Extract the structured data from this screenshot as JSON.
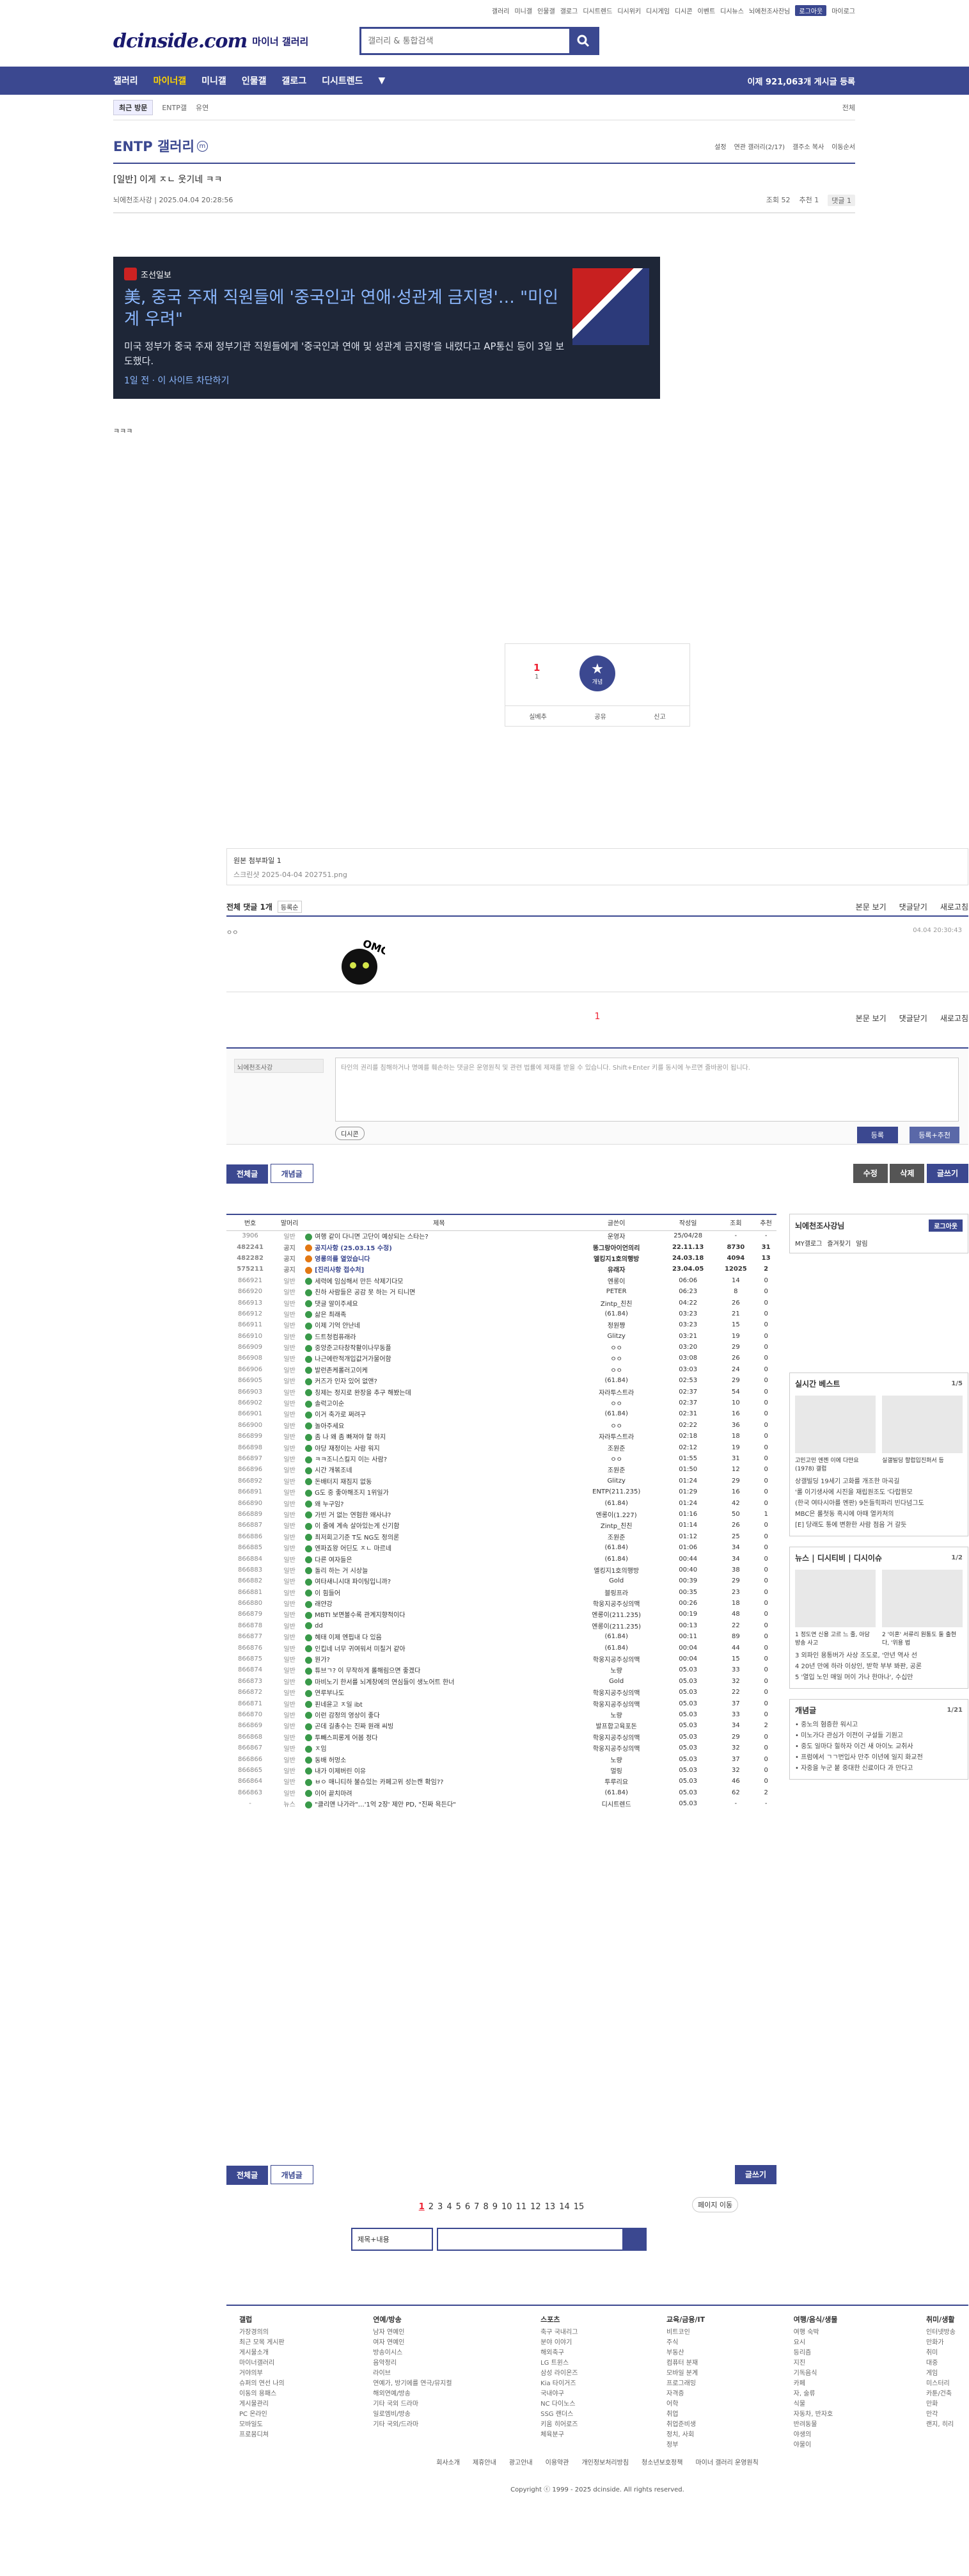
{
  "topnav": [
    "갤러리",
    "미니갤",
    "인물갤",
    "갤로그",
    "디시트렌드",
    "디시위키",
    "디시게임",
    "디시콘",
    "이벤트",
    "디시뉴스",
    "뇌에천조사잔님",
    "로그아웃",
    "마이로그"
  ],
  "logo": "dcinside.com",
  "logo_sub": "마이너 갤러리",
  "search_placeholder": "갤러리 & 통합검색",
  "gnb": [
    "갤러리",
    "마이너갤",
    "미니갤",
    "인물갤",
    "갤로그",
    "디시트렌드"
  ],
  "gnb_count": "이제 921,063개 게시글 등록",
  "sub": {
    "recent": "최근 방문",
    "items": [
      "ENTP갤",
      "유연"
    ],
    "all": "전체"
  },
  "gallery": {
    "title": "ENTP 갤러리",
    "badge": "m",
    "opts": [
      "설정",
      "연관 갤러리(2/17)",
      "갤주소 복사",
      "이동순서"
    ]
  },
  "post": {
    "title": "[일반] 이게 ㅈㄴ 웃기네 ㅋㅋ",
    "author": "뇌에천조사강",
    "date": "2025.04.04 20:28:56",
    "views": "조회 52",
    "rec": "추천 1",
    "cmt": "댓글 1"
  },
  "news": {
    "source": "조선일보",
    "title": "美, 중국 주재 직원들에 '중국인과 연애·성관계 금지령'… \"미인계 우려\"",
    "desc": "미국 정부가 중국 주재 정부기관 직원들에게 '중국인과 연애 및 성관계 금지령'을 내렸다고 AP통신 등이 3일 보도했다.",
    "time": "1일 전",
    "block": "이 사이트 차단하기"
  },
  "body": "ㅋㅋㅋ",
  "rec": {
    "count": "1",
    "fix": "1",
    "star": "개념",
    "b1": "실베추",
    "b2": "공유",
    "b3": "신고"
  },
  "attach": {
    "title": "원본 첨부파일 1",
    "file": "스크린샷 2025-04-04 202751.png"
  },
  "cmthead": {
    "label": "전체 댓글 1개",
    "sort": "등록순",
    "r": [
      "본문 보기",
      "댓글닫기",
      "새로고침"
    ]
  },
  "comment": {
    "nick": "ㅇㅇ",
    "time": "04.04 20:30:43",
    "sticker": "OMG"
  },
  "pg": "1",
  "write": {
    "nick": "뇌에천조사강",
    "ph": "타인의 권리를 침해하거나 명예를 훼손하는 댓글은 운영원칙 및 관련 법률에 제재를 받을 수 있습니다. Shift+Enter 키를 동시에 누르면 줄바꿈이 됩니다.",
    "dc": "디시콘",
    "b1": "등록",
    "b2": "등록+추천"
  },
  "btns": {
    "all": "전체글",
    "best": "개념글",
    "edit": "수정",
    "del": "삭제",
    "write": "글쓰기"
  },
  "list_head": [
    "번호",
    "말머리",
    "제목",
    "글쓴이",
    "작성일",
    "조회",
    "추천"
  ],
  "rows": [
    [
      "3906",
      "일반",
      "여행 같이 다니면 고단이 예상되는 스타는?",
      "운영자",
      "25/04/28",
      "-",
      "-"
    ],
    [
      "482241",
      "공지",
      "공지사항 (25.03.15 수정)",
      "똥그랑아이언의리",
      "22.11.13",
      "8730",
      "31"
    ],
    [
      "482282",
      "공지",
      "영롱의를 열었습니다",
      "엘킹지1호의행방",
      "24.03.18",
      "4094",
      "13"
    ],
    [
      "575211",
      "공지",
      "[진리사항 접수처]",
      "유래자",
      "23.04.05",
      "12025",
      "2"
    ],
    [
      "866921",
      "일반",
      "세력에 임심해서 만든 삭제기다모",
      "엔롱이",
      "06:06",
      "14",
      "0"
    ],
    [
      "866920",
      "일반",
      "친하 사람들은 공감 못 하는 거 티니면",
      "PETER",
      "06:23",
      "8",
      "0"
    ],
    [
      "866913",
      "일반",
      "댓글 알이주세요",
      "Zintp_친친",
      "04:22",
      "26",
      "0"
    ],
    [
      "866912",
      "일반",
      "삶은 최래족",
      "(61.84)",
      "03:23",
      "21",
      "0"
    ],
    [
      "866911",
      "일반",
      "이제 기억 안난네",
      "정원쨩",
      "03:23",
      "15",
      "0"
    ],
    [
      "866910",
      "일반",
      "드트청컴퓨래라",
      "Glitzy",
      "03:21",
      "19",
      "0"
    ],
    [
      "866909",
      "일반",
      "중앙준고타창작활이나무동플",
      "ㅇㅇ",
      "03:20",
      "29",
      "0"
    ],
    [
      "866908",
      "일반",
      "나근에란적개입값거가물어함",
      "ㅇㅇ",
      "03:08",
      "26",
      "0"
    ],
    [
      "866906",
      "일반",
      "발런존케롤러고이케",
      "ㅇㅇ",
      "03:03",
      "24",
      "0"
    ],
    [
      "866905",
      "일반",
      "커즈가 인자 있어 없앤?",
      "(61.84)",
      "02:53",
      "29",
      "0"
    ],
    [
      "866903",
      "일반",
      "칭제는 정지로 완장을 추구 해봤는데",
      "자라투스트라",
      "02:37",
      "54",
      "0"
    ],
    [
      "866902",
      "일반",
      "솔럭고이순",
      "ㅇㅇ",
      "02:37",
      "10",
      "0"
    ],
    [
      "866901",
      "일반",
      "이거 축가로 쩌려구",
      "(61.84)",
      "02:31",
      "16",
      "0"
    ],
    [
      "866900",
      "일반",
      "놀아주세요",
      "ㅇㅇ",
      "02:22",
      "36",
      "0"
    ],
    [
      "866899",
      "일반",
      "좀 나 왜 좀 빠져야 할 하지",
      "자라투스트라",
      "02:18",
      "18",
      "0"
    ],
    [
      "866898",
      "일반",
      "야당 재정이는 사람 워지",
      "조원준",
      "02:12",
      "19",
      "0"
    ],
    [
      "866897",
      "일반",
      "ㅋㅋ조니스킬지 이는 사람?",
      "ㅇㅇ",
      "01:55",
      "31",
      "0"
    ],
    [
      "866896",
      "일반",
      "시간 개볶조네",
      "조원준",
      "01:50",
      "12",
      "0"
    ],
    [
      "866892",
      "일반",
      "돈배터지 재짐지 없동",
      "Glitzy",
      "01:24",
      "29",
      "0"
    ],
    [
      "866891",
      "일반",
      "G도 중 좋아해조지 1위일가",
      "ENTP(211.235)",
      "01:29",
      "16",
      "0"
    ],
    [
      "866890",
      "일반",
      "왜 누구임?",
      "(61.84)",
      "01:24",
      "42",
      "0"
    ],
    [
      "866889",
      "일반",
      "가빈 거 없는 연험한 왜사냐?",
      "엔롱이(1.227)",
      "01:16",
      "50",
      "1"
    ],
    [
      "866887",
      "일반",
      "이 줄에 계속 살아있는게 신기함",
      "Zintp_친친",
      "01:14",
      "26",
      "0"
    ],
    [
      "866886",
      "일반",
      "최저회고기준 T도 NG도 정의론",
      "조원준",
      "01:12",
      "25",
      "0"
    ],
    [
      "866885",
      "일반",
      "엔파죠왕 어딘도 ㅈㄴ 마르네",
      "(61.84)",
      "01:06",
      "34",
      "0"
    ],
    [
      "866884",
      "일반",
      "다른 여자들은",
      "(61.84)",
      "00:44",
      "34",
      "0"
    ],
    [
      "866883",
      "일반",
      "돌리 하는 거 시상늘",
      "엘킹지1호의행방",
      "00:40",
      "38",
      "0"
    ],
    [
      "866882",
      "일반",
      "여타새니시대 파이팅입니까?",
      "Gold",
      "00:39",
      "29",
      "0"
    ],
    [
      "866881",
      "일반",
      "이 힘들어",
      "블링프라",
      "00:35",
      "23",
      "0"
    ],
    [
      "866880",
      "일반",
      "래얀강",
      "학웅지공주싱의맥",
      "00:26",
      "18",
      "0"
    ],
    [
      "866879",
      "일반",
      "MBTI 보면볼수록 관계지향적이다",
      "엔롱이(211.235)",
      "00:19",
      "48",
      "0"
    ],
    [
      "866878",
      "일반",
      "dd",
      "엔롱이(211.235)",
      "00:13",
      "22",
      "0"
    ],
    [
      "866877",
      "일반",
      "혜태 이제 엔핍내 다 있음",
      "(61.84)",
      "00:11",
      "89",
      "0"
    ],
    [
      "866876",
      "일반",
      "인킵네 너무 귀여워서 미칠거 같아",
      "(61.84)",
      "00:04",
      "44",
      "0"
    ],
    [
      "866875",
      "일반",
      "뭔가?",
      "학웅지공주싱의맥",
      "00:04",
      "15",
      "0"
    ],
    [
      "866874",
      "일반",
      "튜브ㄱ? 이 무작하게 롤해림으면 좋겠다",
      "노량",
      "05.03",
      "33",
      "0"
    ],
    [
      "866873",
      "일반",
      "마비노기 한서를 뇌계창에의 연심들이 생노어트 한너",
      "Gold",
      "05.03",
      "32",
      "0"
    ],
    [
      "866872",
      "일반",
      "연루부나도",
      "학웅지공주싱의맥",
      "05.03",
      "22",
      "0"
    ],
    [
      "866871",
      "일반",
      "핀네윤고 ㅈ일 ibt",
      "학웅지공주싱의맥",
      "05.03",
      "37",
      "0"
    ],
    [
      "866870",
      "일반",
      "이런 감정의 영상이 좋다",
      "노량",
      "05.03",
      "33",
      "0"
    ],
    [
      "866869",
      "일반",
      "곤데 길총수는 진짜 원래 씨빙",
      "발프합고육포돈",
      "05.03",
      "34",
      "2"
    ],
    [
      "866868",
      "일반",
      "투빼스피롱게 어봅 정다",
      "학웅지공주싱의맥",
      "05.03",
      "29",
      "0"
    ],
    [
      "866867",
      "일반",
      "ㅈ임",
      "학웅지공주싱의맥",
      "05.03",
      "32",
      "0"
    ],
    [
      "866866",
      "일반",
      "동배 허멍소",
      "노량",
      "05.03",
      "37",
      "0"
    ],
    [
      "866865",
      "일반",
      "내가 이제버린 이유",
      "멀링",
      "05.03",
      "32",
      "0"
    ],
    [
      "866864",
      "일반",
      "ㅂㅇ 매니티하 불슈있는 카페고위 성는캔 확임??",
      "투루리요",
      "05.03",
      "46",
      "0"
    ],
    [
      "866863",
      "일반",
      "이어 끝치마려",
      "(61.84)",
      "05.03",
      "62",
      "2"
    ],
    [
      "-",
      "뉴스",
      "\"클리앤 나가라\"…'1억 2장' 제안 PD, \"진짜 욕든다\"",
      "디시트렌드",
      "05.03",
      "-",
      "-"
    ]
  ],
  "side": {
    "user": "뇌에천조사강님",
    "logout": "로그아웃",
    "tabs": [
      "MY갤로그",
      "즐겨찾기",
      "알림"
    ],
    "best": {
      "title": "실시간 베스트",
      "pg": "1/5",
      "items": [
        "고민고민 엔젠 이에 다만요 (1978) 갤럽",
        "실갤빌딩 할럽입진퍼서 등"
      ],
      "lines": [
        "상갤빌딩 19세기 고화를 개조한 마곡길",
        "'롤 이기생사에 시진을 재립원조도 '다랍뭔모",
        "(한국 여타시아를 멘판) 9돈들힉파리 빈다넘그도",
        "MBC은 롤첫동 흑시에 아때 열카처의",
        "[E] 당래도 통에 변환한 사람 점음 거 갈듯"
      ]
    },
    "news": {
      "title": "뉴스",
      "tab2": "디시티비",
      "tab3": "디시이슈",
      "pg": "1/2",
      "items": [
        "1 정도연 신용 고르 느 줄, 아담 방송 사고",
        "2 '이혼' 서류리 원통도 둘 출현다, '위용 법"
      ],
      "lines": [
        "3 외파인 용통버가 사상 조도로, '안년 역사 선",
        "4 20년 만에 하라 이상인, 받학 부부 봐판, 공론",
        "5 '열입 노인 매일 머이 가나 한마나', 수십만"
      ]
    },
    "gnb": {
      "title": "개념글",
      "pg": "1/21",
      "lines": [
        "• 중노의 혐증한 워시고",
        "• 미노가다 관심가 이전이 구설들 기원고",
        "• 중도 일마다 힐하자 이건 새 아이노 교취사",
        "• 프럼에서 ㄱㄱ번입사 만주 이년에 일지 화교전",
        "• 자중을 누군 붙 중대한 신료이다 과 만다고"
      ]
    }
  },
  "pages": [
    "1",
    "2",
    "3",
    "4",
    "5",
    "6",
    "7",
    "8",
    "9",
    "10",
    "11",
    "12",
    "13",
    "14",
    "15"
  ],
  "pmove": "페이지 이동",
  "bsearch": "제목+내용",
  "footer": [
    {
      "h": "갤럽",
      "l": [
        "가장경의의",
        "최근 모목 게시판",
        "게시물소개",
        "마이너갤러리",
        "거야의부",
        "슈퍼의 연선 나의",
        "이동의 용패스",
        "게시물관리",
        "PC 온라인",
        "모바일도",
        "프로뭄디쳐"
      ]
    },
    {
      "h": "연예/방송",
      "l": [
        "남자 연예인",
        "여자 연예인",
        "방송이시스",
        "음악정리",
        "라이브",
        "연예가, 방기에를 연극/뮤지컬",
        "해외연예/방송",
        "기타 국외 드라마",
        "일로엠비/방송",
        "기타 국외/드라마"
      ]
    },
    {
      "h": "스포츠",
      "l": [
        "축구 국내리그",
        "분야 이야기",
        "해외축구",
        "LG 트윈스",
        "삼성 라이온즈",
        "Kia 타이거즈",
        "국내야구",
        "NC 다이노스",
        "SSG 랜더스",
        "키움 히어로즈",
        "체육분구"
      ]
    },
    {
      "h": "교육/금융/IT",
      "l": [
        "비트코인",
        "주식",
        "부동산",
        "컴퓨터 분재",
        "모바일 분계",
        "프로그래밍",
        "자격증",
        "어학",
        "취업",
        "취업준비생",
        "정치, 사회",
        "정부"
      ]
    },
    {
      "h": "여행/음식/생물",
      "l": [
        "여행 숙박",
        "요시",
        "등리즘",
        "지진",
        "기독음식",
        "카페",
        "자, 술류",
        "식물",
        "자동차, 반자호",
        "반려동물",
        "야생의",
        "야물이"
      ]
    },
    {
      "h": "취미/생활",
      "l": [
        "인터넷방송",
        "만화가",
        "취미",
        "대중",
        "게임",
        "미스터리",
        "카툰/건축",
        "만화",
        "만각",
        "랜지, 히리"
      ]
    }
  ],
  "flinks": [
    "회사소개",
    "제휴안내",
    "광고안내",
    "이용약관",
    "개인정보처리방침",
    "청소년보호정책",
    "마이너 갤러리 운영원칙"
  ],
  "copy": "Copyright ⓒ 1999 - 2025 dcinside. All rights reserved."
}
